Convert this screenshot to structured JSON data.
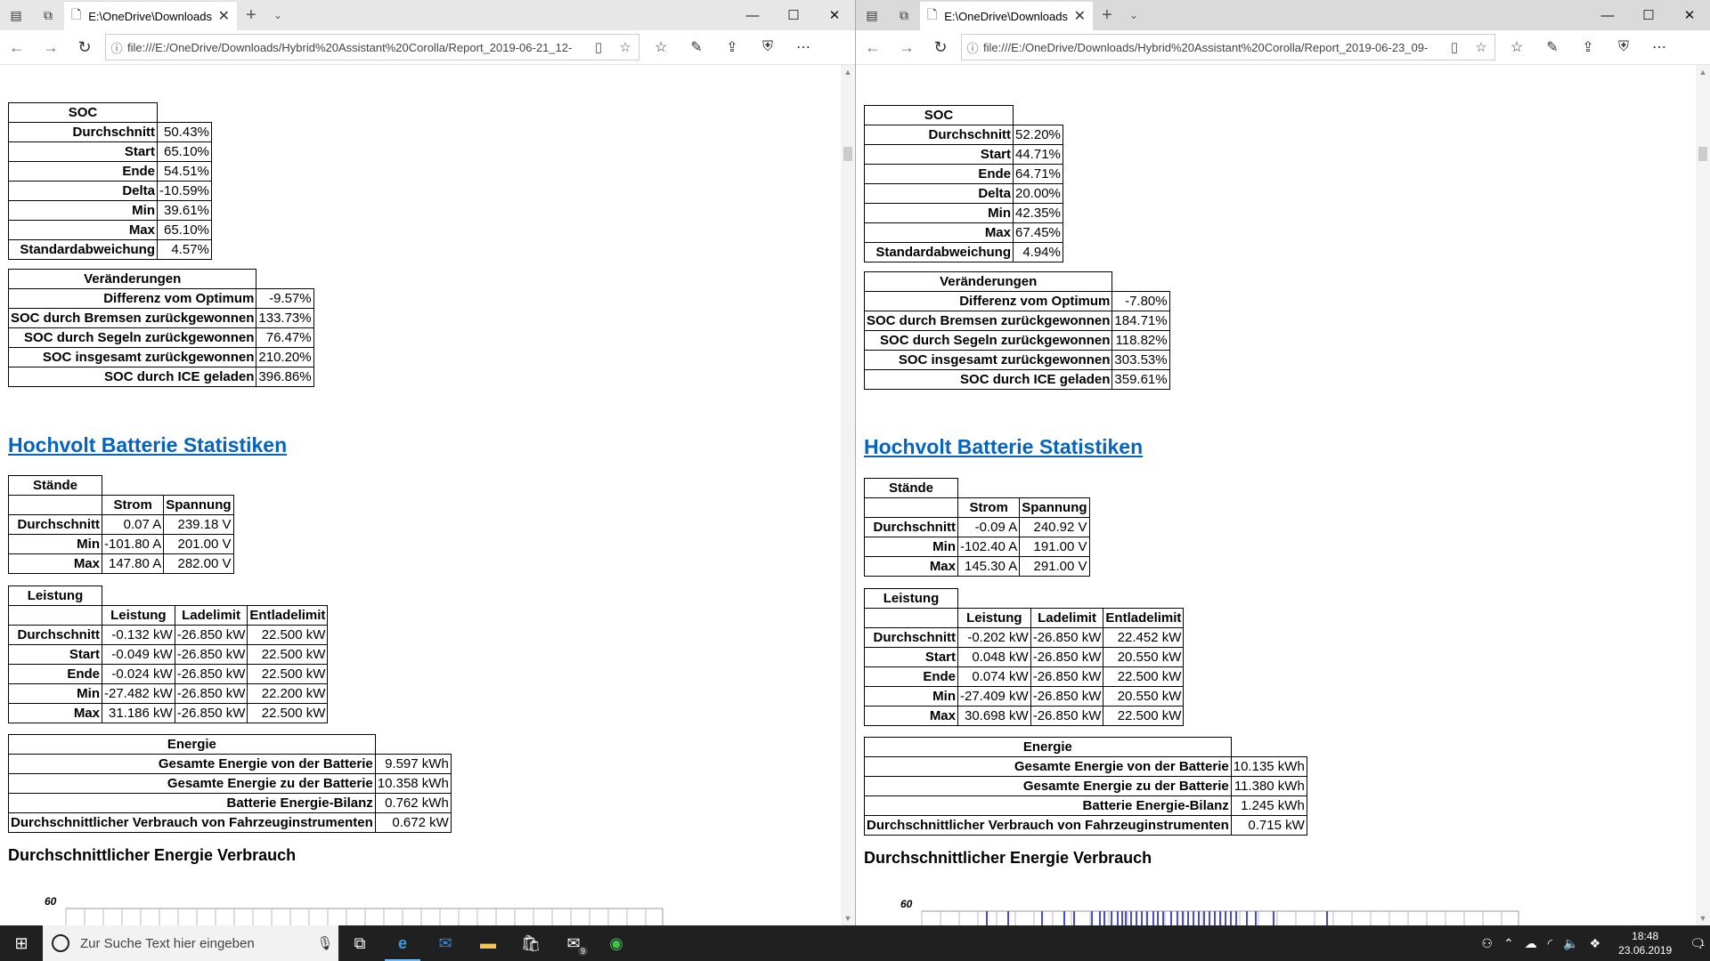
{
  "left": {
    "tab_title": "E:\\OneDrive\\Downloads",
    "url": "file:///E:/OneDrive/Downloads/Hybrid%20Assistant%20Corolla/Report_2019-06-21_12-",
    "soc": {
      "header": "SOC",
      "rows": [
        {
          "label": "Durchschnitt",
          "value": "50.43%"
        },
        {
          "label": "Start",
          "value": "65.10%"
        },
        {
          "label": "Ende",
          "value": "54.51%"
        },
        {
          "label": "Delta",
          "value": "-10.59%"
        },
        {
          "label": "Min",
          "value": "39.61%"
        },
        {
          "label": "Max",
          "value": "65.10%"
        },
        {
          "label": "Standardabweichung",
          "value": "4.57%"
        }
      ]
    },
    "changes": {
      "header": "Veränderungen",
      "rows": [
        {
          "label": "Differenz vom Optimum",
          "value": "-9.57%"
        },
        {
          "label": "SOC durch Bremsen zurückgewonnen",
          "value": "133.73%"
        },
        {
          "label": "SOC durch Segeln zurückgewonnen",
          "value": "76.47%"
        },
        {
          "label": "SOC insgesamt zurückgewonnen",
          "value": "210.20%"
        },
        {
          "label": "SOC durch ICE geladen",
          "value": "396.86%"
        }
      ]
    },
    "hv_title": "Hochvolt Batterie Statistiken",
    "staende": {
      "header": "Stände",
      "col1": "Strom",
      "col2": "Spannung",
      "rows": [
        {
          "label": "Durchschnitt",
          "strom": "0.07 A",
          "spannung": "239.18 V"
        },
        {
          "label": "Min",
          "strom": "-101.80 A",
          "spannung": "201.00 V"
        },
        {
          "label": "Max",
          "strom": "147.80 A",
          "spannung": "282.00 V"
        }
      ]
    },
    "leistung": {
      "header": "Leistung",
      "col1": "Leistung",
      "col2": "Ladelimit",
      "col3": "Entladelimit",
      "rows": [
        {
          "label": "Durchschnitt",
          "a": "-0.132 kW",
          "b": "-26.850 kW",
          "c": "22.500 kW"
        },
        {
          "label": "Start",
          "a": "-0.049 kW",
          "b": "-26.850 kW",
          "c": "22.500 kW"
        },
        {
          "label": "Ende",
          "a": "-0.024 kW",
          "b": "-26.850 kW",
          "c": "22.500 kW"
        },
        {
          "label": "Min",
          "a": "-27.482 kW",
          "b": "-26.850 kW",
          "c": "22.200 kW"
        },
        {
          "label": "Max",
          "a": "31.186 kW",
          "b": "-26.850 kW",
          "c": "22.500 kW"
        }
      ]
    },
    "energie": {
      "header": "Energie",
      "rows": [
        {
          "label": "Gesamte Energie von der Batterie",
          "value": "9.597 kWh"
        },
        {
          "label": "Gesamte Energie zu der Batterie",
          "value": "10.358 kWh"
        },
        {
          "label": "Batterie Energie-Bilanz",
          "value": "0.762 kWh"
        },
        {
          "label": "Durchschnittlicher Verbrauch von Fahrzeuginstrumenten",
          "value": "0.672 kW"
        }
      ]
    },
    "avg_title": "Durchschnittlicher Energie Verbrauch",
    "chart_label": "60"
  },
  "right": {
    "tab_title": "E:\\OneDrive\\Downloads",
    "url": "file:///E:/OneDrive/Downloads/Hybrid%20Assistant%20Corolla/Report_2019-06-23_09-",
    "soc": {
      "header": "SOC",
      "rows": [
        {
          "label": "Durchschnitt",
          "value": "52.20%"
        },
        {
          "label": "Start",
          "value": "44.71%"
        },
        {
          "label": "Ende",
          "value": "64.71%"
        },
        {
          "label": "Delta",
          "value": "20.00%"
        },
        {
          "label": "Min",
          "value": "42.35%"
        },
        {
          "label": "Max",
          "value": "67.45%"
        },
        {
          "label": "Standardabweichung",
          "value": "4.94%"
        }
      ]
    },
    "changes": {
      "header": "Veränderungen",
      "rows": [
        {
          "label": "Differenz vom Optimum",
          "value": "-7.80%"
        },
        {
          "label": "SOC durch Bremsen zurückgewonnen",
          "value": "184.71%"
        },
        {
          "label": "SOC durch Segeln zurückgewonnen",
          "value": "118.82%"
        },
        {
          "label": "SOC insgesamt zurückgewonnen",
          "value": "303.53%"
        },
        {
          "label": "SOC durch ICE geladen",
          "value": "359.61%"
        }
      ]
    },
    "hv_title": "Hochvolt Batterie Statistiken",
    "staende": {
      "header": "Stände",
      "col1": "Strom",
      "col2": "Spannung",
      "rows": [
        {
          "label": "Durchschnitt",
          "strom": "-0.09 A",
          "spannung": "240.92 V"
        },
        {
          "label": "Min",
          "strom": "-102.40 A",
          "spannung": "191.00 V"
        },
        {
          "label": "Max",
          "strom": "145.30 A",
          "spannung": "291.00 V"
        }
      ]
    },
    "leistung": {
      "header": "Leistung",
      "col1": "Leistung",
      "col2": "Ladelimit",
      "col3": "Entladelimit",
      "rows": [
        {
          "label": "Durchschnitt",
          "a": "-0.202 kW",
          "b": "-26.850 kW",
          "c": "22.452 kW"
        },
        {
          "label": "Start",
          "a": "0.048 kW",
          "b": "-26.850 kW",
          "c": "20.550 kW"
        },
        {
          "label": "Ende",
          "a": "0.074 kW",
          "b": "-26.850 kW",
          "c": "22.500 kW"
        },
        {
          "label": "Min",
          "a": "-27.409 kW",
          "b": "-26.850 kW",
          "c": "20.550 kW"
        },
        {
          "label": "Max",
          "a": "30.698 kW",
          "b": "-26.850 kW",
          "c": "22.500 kW"
        }
      ]
    },
    "energie": {
      "header": "Energie",
      "rows": [
        {
          "label": "Gesamte Energie von der Batterie",
          "value": "10.135 kWh"
        },
        {
          "label": "Gesamte Energie zu der Batterie",
          "value": "11.380 kWh"
        },
        {
          "label": "Batterie Energie-Bilanz",
          "value": "1.245 kWh"
        },
        {
          "label": "Durchschnittlicher Verbrauch von Fahrzeuginstrumenten",
          "value": "0.715 kW"
        }
      ]
    },
    "avg_title": "Durchschnittlicher Energie Verbrauch",
    "chart_label": "60"
  },
  "taskbar": {
    "search_placeholder": "Zur Suche Text hier eingeben",
    "mail_badge": "9",
    "time": "18:48",
    "date": "23.06.2019",
    "notif_count": "1"
  },
  "colors": {
    "link": "#0563c1",
    "taskbar": "#202020",
    "chart_bar": "#4a4adf"
  }
}
